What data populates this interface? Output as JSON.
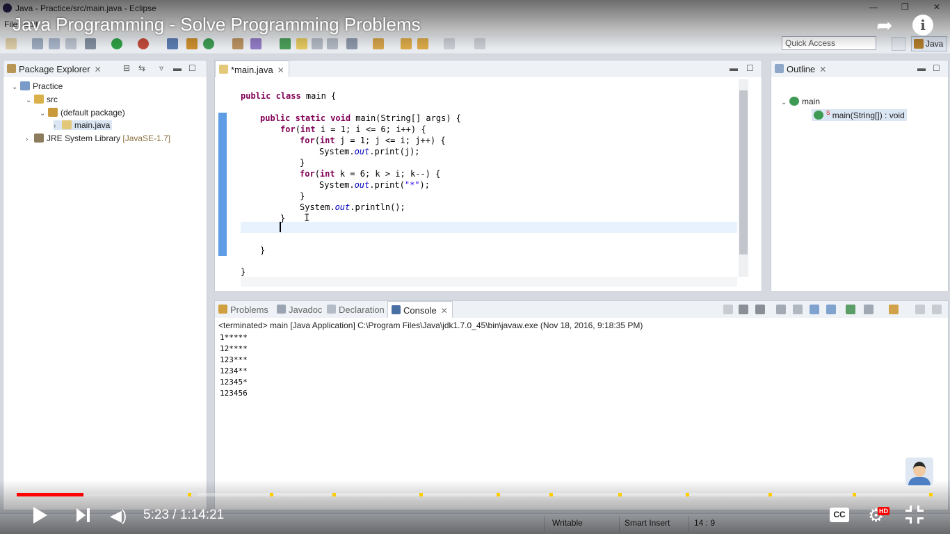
{
  "window": {
    "title": "Java - Practice/src/main.java - Eclipse"
  },
  "menu": {
    "items": [
      "File",
      "Edit"
    ]
  },
  "youtube": {
    "title": "Java Programming - Solve Programming Problems",
    "time": "5:23 / 1:14:21",
    "progress_fraction": 0.073,
    "cc_label": "CC",
    "hd_label": "HD"
  },
  "toolbar": {
    "quick_access_placeholder": "Quick Access",
    "perspective_label": "Java"
  },
  "package_explorer": {
    "tab_label": "Package Explorer",
    "tree": {
      "project": "Practice",
      "src": "src",
      "package": "(default package)",
      "file": "main.java",
      "jre": "JRE System Library",
      "jre_version": "[JavaSE-1.7]"
    }
  },
  "editor": {
    "tab_label": "*main.java",
    "code": {
      "class_kw": "public class",
      "class_rest": " main {",
      "method_kw": "public static void",
      "method_rest": " main(String[] args) {",
      "for1_kw": "for",
      "for1_int": "int",
      "for1_rest": " i = 1; i <= 6; i++) {",
      "for2_int": "int",
      "for2_rest": " j = 1; j <= i; j++) {",
      "print_j_a": "System.",
      "print_j_out": "out",
      "print_j_b": ".print(j);",
      "close_brace": "}",
      "for3_int": "int",
      "for3_rest": " k = 6; k > i; k--) {",
      "print_star_a": "System.",
      "print_star_out": "out",
      "print_star_b": ".print(",
      "print_star_str": "\"*\"",
      "print_star_c": ");",
      "println_a": "System.",
      "println_out": "out",
      "println_b": ".println();"
    }
  },
  "outline": {
    "tab_label": "Outline",
    "class_name": "main",
    "method_sig": "main(String[]) : void",
    "static_marker": "S"
  },
  "bottom_tabs": {
    "problems": "Problems",
    "javadoc": "Javadoc",
    "declaration": "Declaration",
    "console": "Console"
  },
  "console": {
    "header": "<terminated> main [Java Application] C:\\Program Files\\Java\\jdk1.7.0_45\\bin\\javaw.exe (Nov 18, 2016, 9:18:35 PM)",
    "lines": [
      "1*****",
      "12****",
      "123***",
      "1234**",
      "12345*",
      "123456"
    ]
  },
  "statusbar": {
    "writable": "Writable",
    "insert_mode": "Smart Insert",
    "position": "14 : 9"
  },
  "colors": {
    "keyword": "#7f0055",
    "field": "#0000c0",
    "string": "#2a00ff",
    "progress": "#ff0000",
    "chapter_marker": "#ffcc00"
  }
}
